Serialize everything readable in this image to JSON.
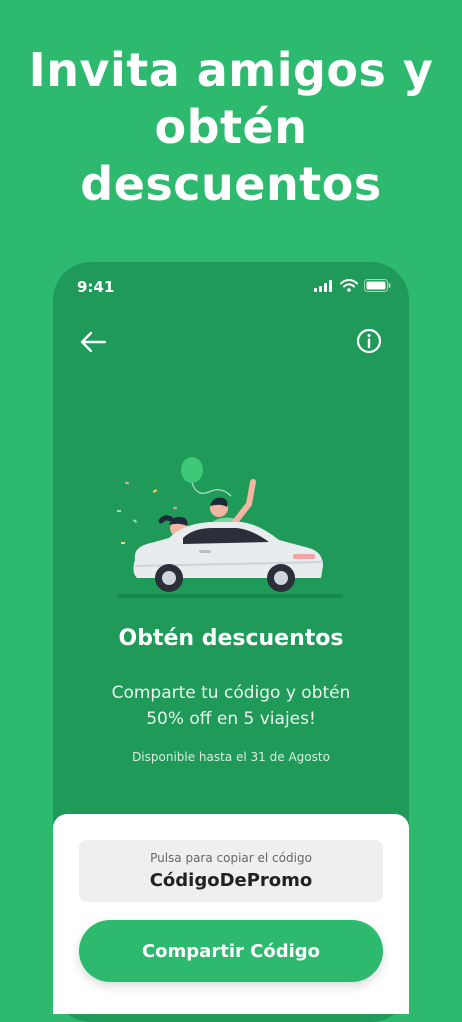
{
  "headline": {
    "line1": "Invita amigos y",
    "line2": "obtén",
    "line3": "descuentos"
  },
  "status_bar": {
    "time": "9:41",
    "icons": [
      "signal-icon",
      "wifi-icon",
      "battery-icon"
    ]
  },
  "nav": {
    "back_icon": "arrow-left-icon",
    "info_icon": "info-circle-icon"
  },
  "content": {
    "title": "Obtén descuentos",
    "subtitle_line1": "Comparte tu código y obtén",
    "subtitle_line2": "50% off en 5 viajes!",
    "availability": "Disponible hasta el 31 de Agosto"
  },
  "promo": {
    "hint": "Pulsa para copiar el código",
    "code": "CódigoDePromo"
  },
  "share_button": {
    "label": "Compartir Código"
  },
  "colors": {
    "background": "#2dba6e",
    "phone_screen": "#1f9a58",
    "button": "#2dba6e",
    "sheet": "#ffffff"
  }
}
